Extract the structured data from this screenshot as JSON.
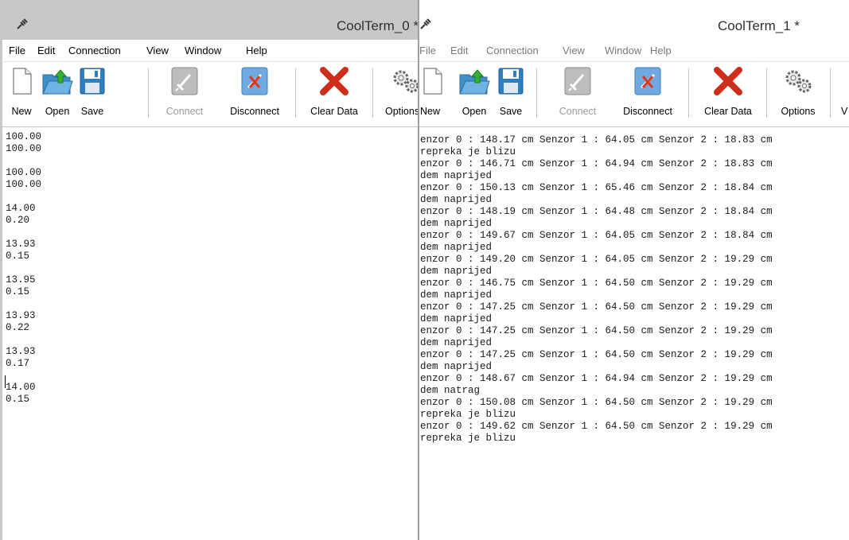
{
  "win0": {
    "title": "CoolTerm_0 *",
    "menu": [
      "File",
      "Edit",
      "Connection",
      "View",
      "Window",
      "Help"
    ],
    "toolbar": {
      "new": "New",
      "open": "Open",
      "save": "Save",
      "connect": "Connect",
      "disconnect": "Disconnect",
      "clear": "Clear Data",
      "options": "Options"
    },
    "lines": [
      "100.00",
      "100.00",
      "",
      "100.00",
      "100.00",
      "",
      "14.00",
      "0.20",
      "",
      "13.93",
      "0.15",
      "",
      "13.95",
      "0.15",
      "",
      "13.93",
      "0.22",
      "",
      "13.93",
      "0.17",
      "",
      "14.00",
      "0.15"
    ]
  },
  "win1": {
    "title": "CoolTerm_1 *",
    "menu": [
      "File",
      "Edit",
      "Connection",
      "View",
      "Window",
      "Help"
    ],
    "toolbar": {
      "new": "New",
      "open": "Open",
      "save": "Save",
      "connect": "Connect",
      "disconnect": "Disconnect",
      "clear": "Clear Data",
      "options": "Options",
      "view": "V"
    },
    "lines": [
      "enzor 0 : 148.17 cm Senzor 1 : 64.05 cm Senzor 2 : 18.83 cm",
      "repreka je blizu",
      "enzor 0 : 146.71 cm Senzor 1 : 64.94 cm Senzor 2 : 18.83 cm",
      "dem naprijed",
      "enzor 0 : 150.13 cm Senzor 1 : 65.46 cm Senzor 2 : 18.84 cm",
      "dem naprijed",
      "enzor 0 : 148.19 cm Senzor 1 : 64.48 cm Senzor 2 : 18.84 cm",
      "dem naprijed",
      "enzor 0 : 149.67 cm Senzor 1 : 64.05 cm Senzor 2 : 18.84 cm",
      "dem naprijed",
      "enzor 0 : 149.20 cm Senzor 1 : 64.05 cm Senzor 2 : 19.29 cm",
      "dem naprijed",
      "enzor 0 : 146.75 cm Senzor 1 : 64.50 cm Senzor 2 : 19.29 cm",
      "dem naprijed",
      "enzor 0 : 147.25 cm Senzor 1 : 64.50 cm Senzor 2 : 19.29 cm",
      "dem naprijed",
      "enzor 0 : 147.25 cm Senzor 1 : 64.50 cm Senzor 2 : 19.29 cm",
      "dem naprijed",
      "enzor 0 : 147.25 cm Senzor 1 : 64.50 cm Senzor 2 : 19.29 cm",
      "dem naprijed",
      "enzor 0 : 148.67 cm Senzor 1 : 64.94 cm Senzor 2 : 19.29 cm",
      "dem natrag",
      "enzor 0 : 150.08 cm Senzor 1 : 64.50 cm Senzor 2 : 19.29 cm",
      "repreka je blizu",
      "enzor 0 : 149.62 cm Senzor 1 : 64.50 cm Senzor 2 : 19.29 cm",
      "repreka je blizu"
    ]
  }
}
